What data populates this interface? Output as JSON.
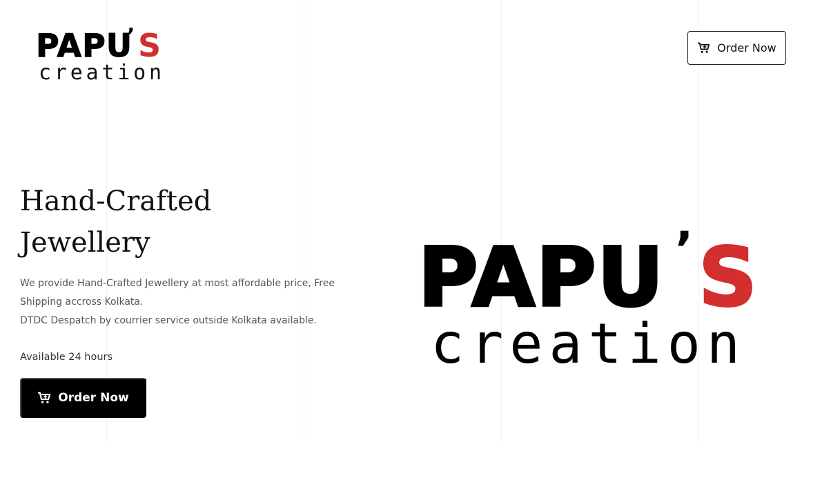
{
  "brand": {
    "name_main": "PAPU",
    "name_apostrophe": "’",
    "name_s": "S",
    "tagline": "creation",
    "colors": {
      "primary": "#000000",
      "accent": "#d32f2f"
    }
  },
  "header": {
    "order_button": {
      "label": "Order Now",
      "icon": "cart-icon"
    }
  },
  "hero": {
    "title_line1": "Hand-Crafted",
    "title_line2": "Jewellery",
    "description_line1": "We provide Hand-Crafted Jewellery at most affordable price, Free Shipping accross Kolkata.",
    "description_line2": "DTDC Despatch by courrier service outside Kolkata available.",
    "availability": "Available 24 hours",
    "order_button": {
      "label": "Order Now",
      "icon": "cart-icon"
    }
  }
}
